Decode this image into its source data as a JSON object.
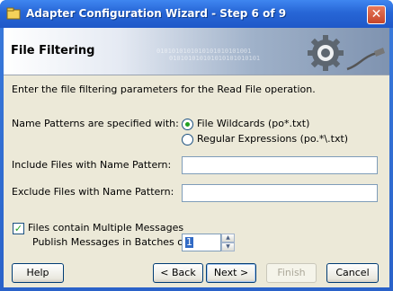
{
  "window": {
    "title": "Adapter Configuration Wizard - Step 6 of 9",
    "close_glyph": "✕"
  },
  "banner": {
    "title": "File Filtering",
    "binary_art": [
      "0101010101010101010101001",
      "010101010101010101010101"
    ],
    "icon": "gear-plug-icon"
  },
  "content": {
    "intro": "Enter the file filtering parameters for the Read File operation.",
    "name_patterns_label": "Name Patterns are specified with:",
    "radio_wildcards": {
      "label": "File Wildcards (po*.txt)",
      "selected": true
    },
    "radio_regex": {
      "label": "Regular Expressions (po.*\\.txt)",
      "selected": false
    },
    "include_label": "Include Files with Name Pattern:",
    "include_value": "",
    "exclude_label": "Exclude Files with Name Pattern:",
    "exclude_value": "",
    "multiple_messages": {
      "label": "Files contain Multiple Messages",
      "checked": true
    },
    "batch_label": "Publish Messages in Batches of:",
    "batch_value": "1"
  },
  "buttons": {
    "help": "Help",
    "back": "< Back",
    "next": "Next >",
    "finish": "Finish",
    "cancel": "Cancel"
  },
  "colors": {
    "titlebar": "#2766d6",
    "dialog_bg": "#ece9d8",
    "radio_dot": "#21a121"
  }
}
